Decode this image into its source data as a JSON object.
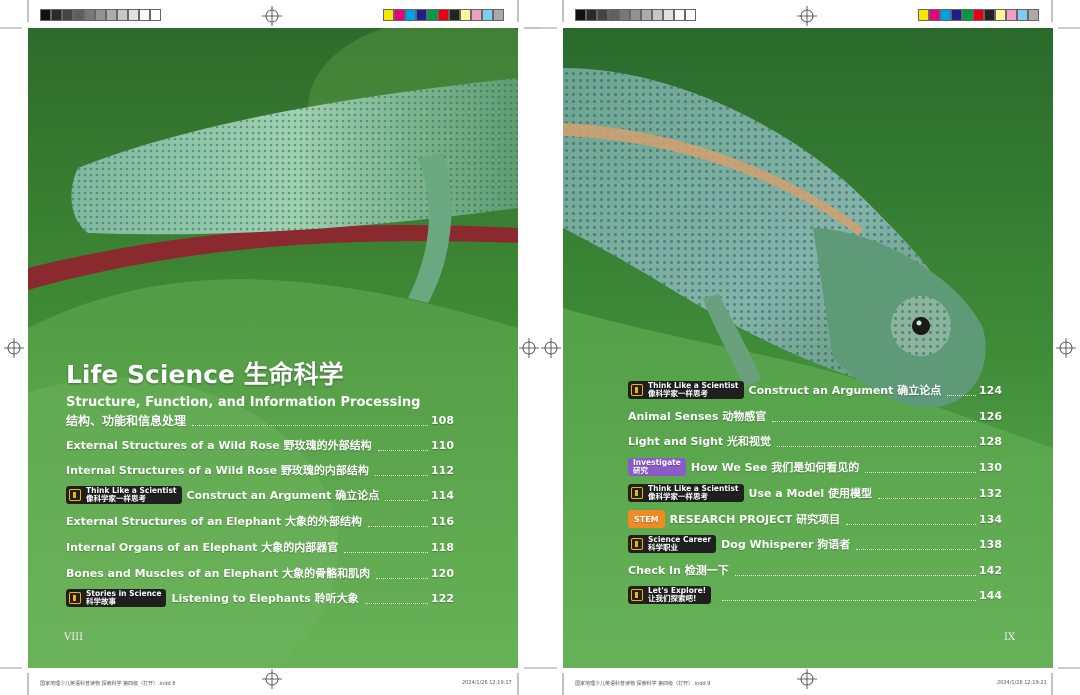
{
  "colors": {
    "page_green": "#5aa64a",
    "tag_dark": "#1f1f1f",
    "tag_purple": "#8b5cc9",
    "tag_orange": "#f08a24",
    "tag_icon": "#f3b100"
  },
  "left_page": {
    "section_title": "Life Science 生命科学",
    "unit_title_en": "Structure, Function, and Information Processing",
    "unit_title_cn": "结构、功能和信息处理",
    "unit_page": "108",
    "entries": [
      {
        "label": "External Structures of a Wild Rose 野玫瑰的外部结构",
        "page": "110"
      },
      {
        "label": "Internal Structures of a Wild Rose 野玫瑰的内部结构",
        "page": "112"
      },
      {
        "tag_en": "Think Like a Scientist",
        "tag_cn": "像科学家一样思考",
        "label": "Construct an Argument 确立论点",
        "page": "114"
      },
      {
        "label": "External Structures of an Elephant 大象的外部结构",
        "page": "116"
      },
      {
        "label": "Internal Organs of an Elephant 大象的内部器官",
        "page": "118"
      },
      {
        "label": "Bones and Muscles of an Elephant 大象的骨骼和肌肉",
        "page": "120"
      },
      {
        "tag_en": "Stories in Science",
        "tag_cn": "科学故事",
        "label": "Listening to Elephants 聆听大象",
        "page": "122"
      }
    ],
    "folio": "VIII",
    "slug_left": "国家地理少儿英语科普读物 探索科学 第四级（打开）.indd   8",
    "slug_right": "2024/1/26   12:19:17"
  },
  "right_page": {
    "entries": [
      {
        "tag_en": "Think Like a Scientist",
        "tag_cn": "像科学家一样思考",
        "label": "Construct an Argument 确立论点",
        "page": "124"
      },
      {
        "label": "Animal Senses 动物感官",
        "page": "126"
      },
      {
        "label": "Light and Sight 光和视觉",
        "page": "128"
      },
      {
        "tag_en": "Investigate",
        "tag_cn": "研究",
        "label": "How We See 我们是如何看见的",
        "page": "130"
      },
      {
        "tag_en": "Think Like a Scientist",
        "tag_cn": "像科学家一样思考",
        "label": "Use a Model 使用模型",
        "page": "132"
      },
      {
        "tag_single": "STEM",
        "label": "RESEARCH PROJECT 研究项目",
        "page": "134"
      },
      {
        "tag_en": "Science Career",
        "tag_cn": "科学职业",
        "label": "Dog Whisperer 狗语者",
        "page": "138"
      },
      {
        "label": "Check In 检测一下",
        "page": "142"
      },
      {
        "tag_en": "Let's Explore!",
        "tag_cn": "让我们探索吧!",
        "label": "",
        "page": "144"
      }
    ],
    "folio": "IX",
    "slug_left": "国家地理少儿英语科普读物 探索科学 第四级（打开）.indd   9",
    "slug_right": "2024/1/26   12:19:21"
  }
}
